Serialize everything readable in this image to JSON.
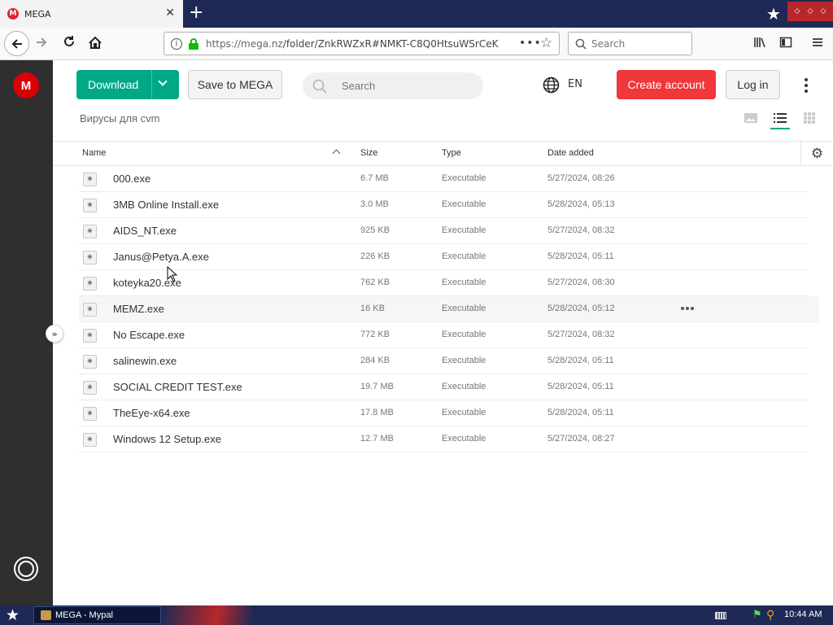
{
  "browser": {
    "tab_title": "MEGA",
    "tab_favicon_letter": "M",
    "new_tab_glyph": "+",
    "url_path": "https://mega.nz/folder/ZnkRWZxR#NMKT-C8Q0HtsuWSrCeK",
    "search_placeholder": "Search",
    "window_buttons": [
      "◇",
      "◇",
      "◇"
    ]
  },
  "mega": {
    "logo_letter": "M",
    "download_label": "Download",
    "save_label": "Save to MEGA",
    "search_placeholder": "Search",
    "language": "EN",
    "create_account_label": "Create account",
    "login_label": "Log in",
    "folder_name": "Вирусы для cvm",
    "accent_color": "#00a886",
    "create_color": "#f0373a"
  },
  "table": {
    "headers": {
      "name": "Name",
      "size": "Size",
      "type": "Type",
      "date": "Date added"
    },
    "rows": [
      {
        "name": "000.exe",
        "size": "6.7 MB",
        "type": "Executable",
        "date": "5/27/2024, 08:26"
      },
      {
        "name": "3MB Online Install.exe",
        "size": "3.0 MB",
        "type": "Executable",
        "date": "5/28/2024, 05:13"
      },
      {
        "name": "AIDS_NT.exe",
        "size": "925 KB",
        "type": "Executable",
        "date": "5/27/2024, 08:32"
      },
      {
        "name": "Janus@Petya.A.exe",
        "size": "226 KB",
        "type": "Executable",
        "date": "5/28/2024, 05:11"
      },
      {
        "name": "koteyka20.exe",
        "size": "762 KB",
        "type": "Executable",
        "date": "5/27/2024, 08:30"
      },
      {
        "name": "MEMZ.exe",
        "size": "16 KB",
        "type": "Executable",
        "date": "5/28/2024, 05:12"
      },
      {
        "name": "No Escape.exe",
        "size": "772 KB",
        "type": "Executable",
        "date": "5/27/2024, 08:32"
      },
      {
        "name": "salinewin.exe",
        "size": "284 KB",
        "type": "Executable",
        "date": "5/28/2024, 05:11"
      },
      {
        "name": "SOCIAL CREDIT TEST.exe",
        "size": "19.7 MB",
        "type": "Executable",
        "date": "5/28/2024, 05:11"
      },
      {
        "name": "TheEye-x64.exe",
        "size": "17.8 MB",
        "type": "Executable",
        "date": "5/28/2024, 05:11"
      },
      {
        "name": "Windows 12 Setup.exe",
        "size": "12.7 MB",
        "type": "Executable",
        "date": "5/27/2024, 08:27"
      }
    ],
    "hovered_row": "MEMZ.exe"
  },
  "taskbar": {
    "task_label": "MEGA - Mypal",
    "clock": "10:44 AM"
  }
}
